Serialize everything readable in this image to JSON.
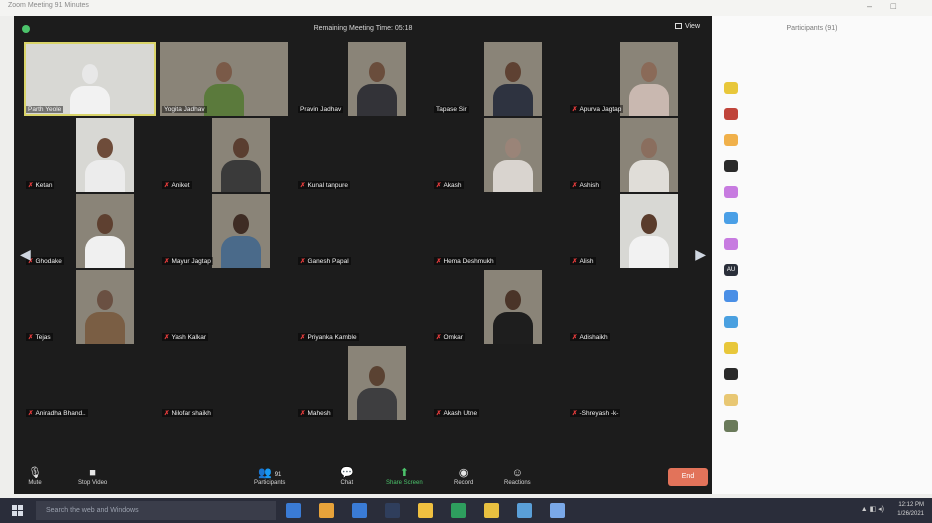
{
  "window": {
    "title": "Zoom Meeting 91 Minutes",
    "controls": [
      "–",
      "□"
    ]
  },
  "meeting": {
    "timer": "Remaining Meeting Time: 05:18",
    "view_label": "View"
  },
  "tiles": [
    {
      "name": "Parth Yeole",
      "video": true,
      "muted": false,
      "active": true,
      "skin": "#e8e8e8",
      "shirt": "#f2f2f2"
    },
    {
      "name": "Yogita Jadhav",
      "video": true,
      "muted": false,
      "skin": "#7a5a48",
      "shirt": "#5b7a3c"
    },
    {
      "name": "Pravin Jadhav",
      "video": true,
      "muted": false,
      "skin": "#6a4d3c",
      "shirt": "#333338"
    },
    {
      "name": "Tapase Sir",
      "video": true,
      "muted": false,
      "skin": "#5e4132",
      "shirt": "#2e3340"
    },
    {
      "name": "Apurva Jagtap",
      "video": true,
      "muted": true,
      "skin": "#8a6a58",
      "shirt": "#c9b8b0"
    },
    {
      "name": "Ketan",
      "video": true,
      "muted": true,
      "skin": "#6e4c3a",
      "shirt": "#ececec"
    },
    {
      "name": "Aniket",
      "video": true,
      "muted": true,
      "skin": "#5a3e30",
      "shirt": "#3a3a3a"
    },
    {
      "name": "Kunal tanpure",
      "video": false,
      "muted": true
    },
    {
      "name": "Akash",
      "video": true,
      "muted": true,
      "skin": "#9a8478",
      "shirt": "#d9d4cf"
    },
    {
      "name": "Ashish",
      "video": true,
      "muted": true,
      "skin": "#8a6e5e",
      "shirt": "#e0ddd8"
    },
    {
      "name": "Ghodake",
      "video": true,
      "muted": true,
      "skin": "#5e4030",
      "shirt": "#f0f0f0"
    },
    {
      "name": "Mayur Jagtap",
      "video": true,
      "muted": true,
      "skin": "#3e2c24",
      "shirt": "#4a6a8a"
    },
    {
      "name": "Ganesh Papal",
      "video": false,
      "muted": true
    },
    {
      "name": "Hema Deshmukh",
      "video": false,
      "muted": true
    },
    {
      "name": "Alish",
      "video": true,
      "muted": true,
      "skin": "#5a3c2c",
      "shirt": "#f2f2f2"
    },
    {
      "name": "Tejas",
      "video": true,
      "muted": true,
      "skin": "#6a5042",
      "shirt": "#7a5e44"
    },
    {
      "name": "Yash Kalkar",
      "video": false,
      "muted": true
    },
    {
      "name": "Priyanka Kamble",
      "video": false,
      "muted": true
    },
    {
      "name": "Omkar",
      "video": true,
      "muted": true,
      "skin": "#4a3428",
      "shirt": "#1e1e1e"
    },
    {
      "name": "Adishaikh",
      "video": false,
      "muted": true
    },
    {
      "name": "Aniradha Bhand..",
      "video": false,
      "muted": true
    },
    {
      "name": "Nilofar shaikh",
      "video": false,
      "muted": true
    },
    {
      "name": "Mahesh",
      "video": true,
      "muted": true,
      "skin": "#5a4232",
      "shirt": "#3e3e40"
    },
    {
      "name": "Akash Utne",
      "video": false,
      "muted": true
    },
    {
      "name": "-Shreyash -k-",
      "video": false,
      "muted": true
    }
  ],
  "toolbar": {
    "mute": "Mute",
    "stop_video": "Stop Video",
    "participants": "Participants",
    "participants_count": "91",
    "chat": "Chat",
    "share_screen": "Share Screen",
    "record": "Record",
    "reactions": "Reactions",
    "end": "End"
  },
  "panel": {
    "title": "Participants (91)",
    "avatar_colors": [
      "#e8c73a",
      "#c0443a",
      "#f0b04a",
      "#2a2a2a",
      "#c77be0",
      "#4a9fe6",
      "#c77be0",
      "#2a2f3a",
      "#4a8fe6",
      "#4aa0e0",
      "#e8c73a",
      "#2a2a2a",
      "#e8c773",
      "#6a7a5a"
    ],
    "avatar_labels": [
      "",
      "",
      "",
      "",
      "",
      "",
      "",
      "AU",
      "",
      "",
      "",
      "",
      "",
      ""
    ]
  },
  "taskbar": {
    "search_placeholder": "Search the web and Windows",
    "time": "12:12 PM",
    "date": "1/26/2021",
    "app_colors": [
      "#3a7bd5",
      "#e8a33a",
      "#3a7bd5",
      "#2f3e5c",
      "#f0c040",
      "#2e9e5e",
      "#e8c040",
      "#5a9fd8",
      "#7aa8e8"
    ]
  }
}
